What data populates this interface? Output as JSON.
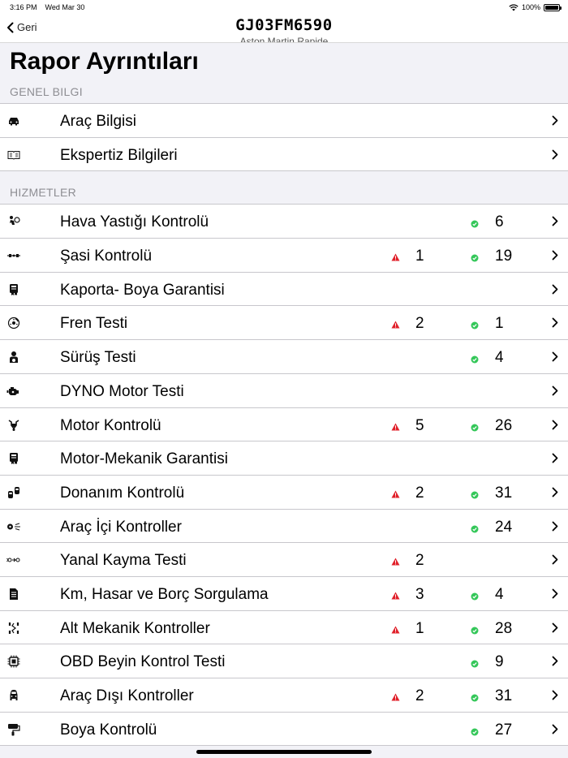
{
  "status": {
    "time": "3:16 PM",
    "date": "Wed Mar 30",
    "battery": "100%"
  },
  "nav": {
    "back_label": "Geri",
    "title": "GJ03FM6590",
    "subtitle": "Aston Martin Rapide"
  },
  "page_title": "Rapor Ayrıntıları",
  "sections": [
    {
      "header": "GENEL BILGI",
      "rows": [
        {
          "icon": "car-icon",
          "label": "Araç Bilgisi"
        },
        {
          "icon": "book-icon",
          "label": "Ekspertiz Bilgileri"
        }
      ]
    },
    {
      "header": "HIZMETLER",
      "rows": [
        {
          "icon": "airbag-icon",
          "label": "Hava Yastığı Kontrolü",
          "ok": "6"
        },
        {
          "icon": "chassis-icon",
          "label": "Şasi Kontrolü",
          "warn": "1",
          "ok": "19"
        },
        {
          "icon": "warranty-icon",
          "label": "Kaporta- Boya Garantisi"
        },
        {
          "icon": "brake-disc-icon",
          "label": "Fren Testi",
          "warn": "2",
          "ok": "1"
        },
        {
          "icon": "driver-icon",
          "label": "Sürüş Testi",
          "ok": "4"
        },
        {
          "icon": "engine-icon",
          "label": "DYNO Motor Testi"
        },
        {
          "icon": "motor-icon",
          "label": "Motor Kontrolü",
          "warn": "5",
          "ok": "26"
        },
        {
          "icon": "warranty-icon",
          "label": "Motor-Mekanik Garantisi"
        },
        {
          "icon": "equipment-icon",
          "label": "Donanım Kontrolü",
          "warn": "2",
          "ok": "31"
        },
        {
          "icon": "interior-icon",
          "label": "Araç İçi Kontroller",
          "ok": "24"
        },
        {
          "icon": "side-slip-icon",
          "label": "Yanal Kayma Testi",
          "warn": "2"
        },
        {
          "icon": "document-icon",
          "label": "Km, Hasar ve Borç Sorgulama",
          "warn": "3",
          "ok": "4"
        },
        {
          "icon": "suspension-icon",
          "label": "Alt Mekanik Kontroller",
          "warn": "1",
          "ok": "28"
        },
        {
          "icon": "chip-icon",
          "label": "OBD Beyin Kontrol Testi",
          "ok": "9"
        },
        {
          "icon": "exterior-icon",
          "label": "Araç Dışı Kontroller",
          "warn": "2",
          "ok": "31"
        },
        {
          "icon": "paint-icon",
          "label": "Boya Kontrolü",
          "ok": "27"
        }
      ]
    }
  ],
  "colors": {
    "warn": "#e0202a",
    "ok": "#34c759",
    "separator": "#c8c7cc",
    "grouped_bg": "#f2f2f7"
  }
}
